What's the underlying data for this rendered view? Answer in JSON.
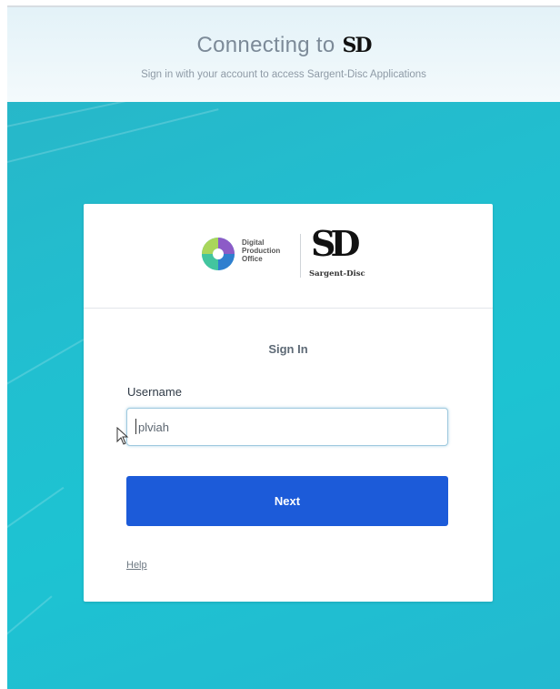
{
  "header": {
    "title": "Connecting to",
    "brand_mark": "SD",
    "subtitle": "Sign in with your account to access Sargent-Disc Applications"
  },
  "card": {
    "logos": {
      "dpo_lines": [
        "Digital",
        "Production",
        "Office"
      ],
      "sd_mark": "SD",
      "sd_name": "Sargent-Disc"
    },
    "title": "Sign In",
    "username": {
      "label": "Username",
      "value": "plviah",
      "placeholder": ""
    },
    "next_button": "Next",
    "help_link": "Help"
  },
  "colors": {
    "background_teal": "#21bfd0",
    "next_button_blue": "#1c5bd9",
    "header_bg": "#eaf5f9"
  },
  "icons": [
    "dpo-aperture-icon",
    "mouse-pointer-icon"
  ]
}
